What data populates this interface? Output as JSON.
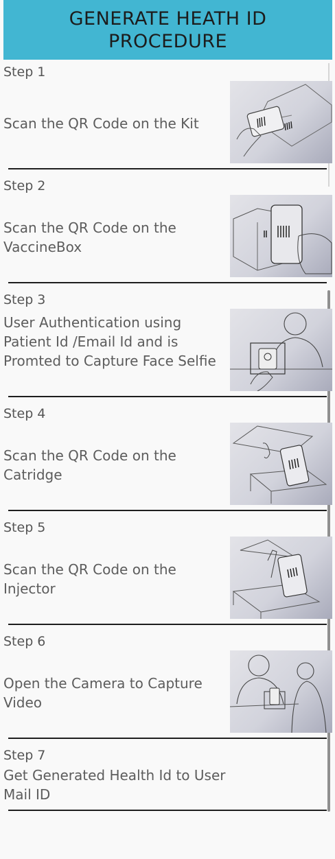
{
  "header": {
    "title_line1": "GENERATE HEATH ID",
    "title_line2": "PROCEDURE"
  },
  "steps": [
    {
      "title": "Step 1",
      "description": "Scan the QR Code on the Kit",
      "image_icon": "phone-scan-kit-illustration"
    },
    {
      "title": "Step 2",
      "description": "Scan the QR Code on the VaccineBox",
      "image_icon": "phone-scan-box-illustration"
    },
    {
      "title": "Step 3",
      "description": "User Authentication using Patient Id /Email Id and is Promted to Capture Face Selfie",
      "image_icon": "face-selfie-illustration"
    },
    {
      "title": "Step 4",
      "description": "Scan the QR Code on the Catridge",
      "image_icon": "phone-scan-cartridge-illustration"
    },
    {
      "title": "Step 5",
      "description": "Scan the QR Code on the Injector",
      "image_icon": "phone-scan-injector-illustration"
    },
    {
      "title": "Step 6",
      "description": "Open the Camera to Capture Video",
      "image_icon": "camera-video-illustration"
    },
    {
      "title": "Step 7",
      "description": "Get Generated Health Id to User Mail ID"
    }
  ],
  "colors": {
    "header_bg": "#42b6d2",
    "page_bg": "#f9f9f9",
    "divider": "#1e1e1e"
  }
}
